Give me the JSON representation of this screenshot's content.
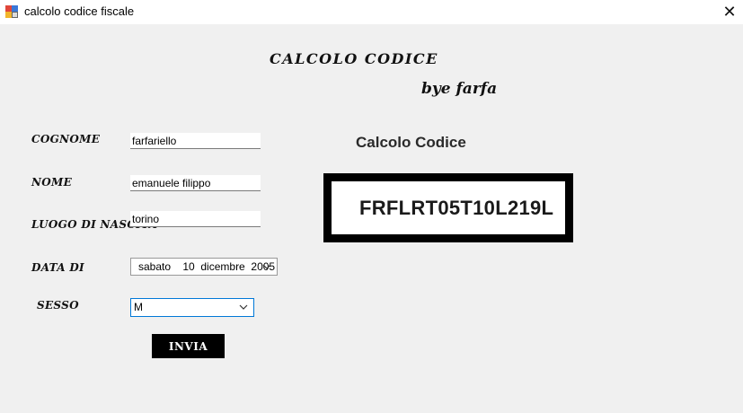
{
  "window": {
    "title": "calcolo codice fiscale",
    "close_symbol": "✕"
  },
  "header": {
    "title": "CALCOLO CODICE",
    "subtitle": "bye farfa"
  },
  "form": {
    "cognome_label": "COGNOME",
    "cognome_value": "farfariello",
    "nome_label": "NOME",
    "nome_value": "emanuele filippo",
    "luogo_label": "LUOGO DI NASCITA",
    "luogo_value": "torino",
    "data_label": "DATA DI",
    "data_value": "sabato    10  dicembre  2005",
    "sesso_label": "SESSO",
    "sesso_value": "M",
    "submit_label": "INVIA"
  },
  "result": {
    "label": "Calcolo Codice",
    "value": "FRFLRT05T10L219L"
  },
  "colors": {
    "background": "#f0f0f0",
    "button": "#000000",
    "combo_focus_border": "#0078d7"
  }
}
